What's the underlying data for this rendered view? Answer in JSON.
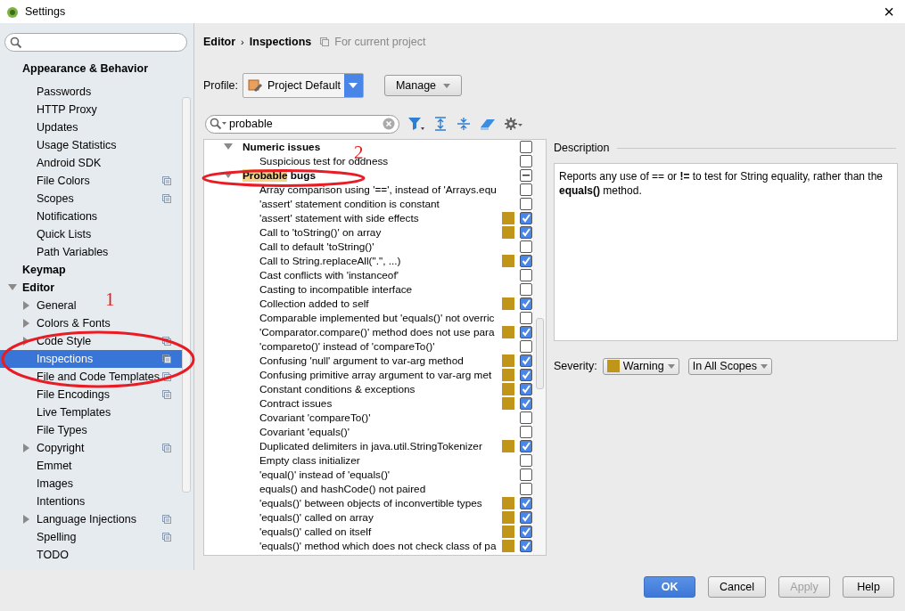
{
  "window": {
    "title": "Settings",
    "close": "×"
  },
  "sidebar": {
    "tree": [
      {
        "label": "Appearance & Behavior",
        "selected": false,
        "children": [
          {
            "children": [
              {
                "label": "Passwords",
                "selected": false
              },
              {
                "label": "HTTP Proxy",
                "selected": false
              },
              {
                "label": "Updates",
                "selected": false
              },
              {
                "label": "Usage Statistics",
                "selected": false
              },
              {
                "label": "Android SDK",
                "selected": false
              }
            ]
          },
          {
            "label": "File Colors",
            "selected": false,
            "project": true
          },
          {
            "label": "Scopes",
            "selected": false,
            "project": true
          },
          {
            "label": "Notifications",
            "selected": false
          },
          {
            "label": "Quick Lists",
            "selected": false
          },
          {
            "label": "Path Variables",
            "selected": false
          }
        ]
      },
      {
        "label": "Keymap",
        "selected": false
      },
      {
        "label": "Editor",
        "selected": false,
        "expanded": true,
        "children": [
          {
            "label": "General",
            "selected": false,
            "expanded": false
          },
          {
            "label": "Colors & Fonts",
            "selected": false,
            "expanded": false
          },
          {
            "label": "Code Style",
            "selected": false,
            "expanded": false,
            "project": true
          },
          {
            "label": "Inspections",
            "selected": true,
            "project": true
          },
          {
            "label": "File and Code Templates",
            "selected": false,
            "project": true
          },
          {
            "label": "File Encodings",
            "selected": false,
            "project": true
          },
          {
            "label": "Live Templates",
            "selected": false
          },
          {
            "label": "File Types",
            "selected": false
          },
          {
            "label": "Copyright",
            "selected": false,
            "expanded": false,
            "project": true
          },
          {
            "label": "Emmet",
            "selected": false
          },
          {
            "label": "Images",
            "selected": false
          },
          {
            "label": "Intentions",
            "selected": false
          },
          {
            "label": "Language Injections",
            "selected": false,
            "expanded": false,
            "project": true
          },
          {
            "label": "Spelling",
            "selected": false,
            "project": true
          },
          {
            "label": "TODO",
            "selected": false
          }
        ]
      }
    ]
  },
  "breadcrumb": {
    "parent": "Editor",
    "separator": "›",
    "current": "Inspections",
    "scope": "For current project"
  },
  "profile": {
    "label": "Profile:",
    "value": "Project Default",
    "manage": "Manage"
  },
  "search": {
    "value": "probable"
  },
  "inspections": [
    {
      "label": "Numeric issues",
      "expanded": true,
      "partial": false,
      "children": [
        {
          "label": "Suspicious test for oddness",
          "checked": false,
          "warning": false
        }
      ]
    },
    {
      "match": "Probable",
      "label": "bugs",
      "expanded": true,
      "partial": true,
      "children": [
        {
          "label": "Array comparison using '==', instead of 'Arrays.equ",
          "checked": false,
          "warning": false
        },
        {
          "label": "'assert' statement condition is constant",
          "checked": false,
          "warning": false
        },
        {
          "label": "'assert' statement with side effects",
          "checked": true,
          "warning": true
        },
        {
          "label": "Call to 'toString()' on array",
          "checked": true,
          "warning": true
        },
        {
          "label": "Call to default 'toString()'",
          "checked": false,
          "warning": false
        },
        {
          "label": "Call to String.replaceAll(\".\", ...)",
          "checked": true,
          "warning": true
        },
        {
          "label": "Cast conflicts with 'instanceof'",
          "checked": false,
          "warning": false
        },
        {
          "label": "Casting to incompatible interface",
          "checked": false,
          "warning": false
        },
        {
          "label": "Collection added to self",
          "checked": true,
          "warning": true
        },
        {
          "label": "Comparable implemented but 'equals()' not overric",
          "checked": false,
          "warning": false
        },
        {
          "label": "'Comparator.compare()' method does not use para",
          "checked": true,
          "warning": true
        },
        {
          "label": "'compareto()' instead of 'compareTo()'",
          "checked": false,
          "warning": false
        },
        {
          "label": "Confusing 'null' argument to var-arg method",
          "checked": true,
          "warning": true
        },
        {
          "label": "Confusing primitive array argument to var-arg met",
          "checked": true,
          "warning": true
        },
        {
          "label": "Constant conditions & exceptions",
          "checked": true,
          "warning": true
        },
        {
          "label": "Contract issues",
          "checked": true,
          "warning": true
        },
        {
          "label": "Covariant 'compareTo()'",
          "checked": false,
          "warning": false
        },
        {
          "label": "Covariant 'equals()'",
          "checked": false,
          "warning": false
        },
        {
          "label": "Duplicated delimiters in java.util.StringTokenizer",
          "checked": true,
          "warning": true
        },
        {
          "label": "Empty class initializer",
          "checked": false,
          "warning": false
        },
        {
          "label": "'equal()' instead of 'equals()'",
          "checked": false,
          "warning": false
        },
        {
          "label": "equals() and hashCode() not paired",
          "checked": false,
          "warning": false
        },
        {
          "label": "'equals()' between objects of inconvertible types",
          "checked": true,
          "warning": true
        },
        {
          "label": "'equals()' called on array",
          "checked": true,
          "warning": true
        },
        {
          "label": "'equals()' called on itself",
          "checked": true,
          "warning": true
        },
        {
          "label": "'equals()' method which does not check class of pa",
          "checked": true,
          "warning": true
        }
      ]
    }
  ],
  "description": {
    "title": "Description",
    "text": "Reports any use of == or **!=** to test for String equality, rather than the **equals()** method."
  },
  "severity": {
    "label": "Severity:",
    "value": "Warning",
    "color": "#c0951a",
    "scope": "In All Scopes"
  },
  "buttons": [
    {
      "label": "OK",
      "kind": "primary"
    },
    {
      "label": "Cancel",
      "kind": "normal"
    },
    {
      "label": "Apply",
      "kind": "disabled"
    },
    {
      "label": "Help",
      "kind": "normal"
    }
  ],
  "annotations": [
    {
      "label": "1"
    },
    {
      "label": "2"
    }
  ]
}
